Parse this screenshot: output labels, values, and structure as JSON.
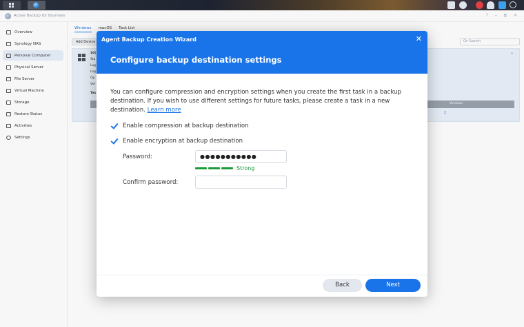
{
  "app": {
    "title": "Active Backup for Business",
    "window_controls": "? – ⧉ ✕"
  },
  "sidebar": {
    "items": [
      {
        "label": "Overview",
        "icon": "overview-icon",
        "active": false
      },
      {
        "label": "Synology NAS",
        "icon": "nas-icon",
        "active": false
      },
      {
        "label": "Personal Computer",
        "icon": "computer-icon",
        "active": true
      },
      {
        "label": "Physical Server",
        "icon": "server-icon",
        "active": false
      },
      {
        "label": "File Server",
        "icon": "file-server-icon",
        "active": false
      },
      {
        "label": "Virtual Machine",
        "icon": "vm-icon",
        "active": false
      },
      {
        "label": "Storage",
        "icon": "storage-icon",
        "active": false
      },
      {
        "label": "Restore Status",
        "icon": "restore-icon",
        "active": false
      },
      {
        "label": "Activities",
        "icon": "activities-icon",
        "active": false
      },
      {
        "label": "Settings",
        "icon": "gear-icon",
        "active": false
      }
    ]
  },
  "main": {
    "tabs": [
      "Windows",
      "macOS",
      "Task List"
    ],
    "active_tab": "Windows",
    "add_device_label": "Add Device",
    "search_placeholder": "Q▾ Search",
    "device": {
      "name_partial": "10(",
      "lines": [
        "Sta",
        "Log",
        "Log",
        "Op",
        "Ver"
      ],
      "tasks_label": "Tas"
    },
    "grid": {
      "col_versions": "Versions",
      "versions_value": "2"
    }
  },
  "wizard": {
    "window_title": "Agent Backup Creation Wizard",
    "close_glyph": "✕",
    "step_title": "Configure backup destination settings",
    "description": "You can configure compression and encryption settings when you create the first task in a backup destination. If you wish to use different settings for future tasks, please create a task in a new destination.",
    "learn_more": "Learn more",
    "options": [
      {
        "label": "Enable compression at backup destination",
        "checked": true
      },
      {
        "label": "Enable encryption at backup destination",
        "checked": true
      }
    ],
    "password": {
      "label": "Password:",
      "value": "●●●●●●●●●●●",
      "strength": "Strong",
      "strength_level": 1.0,
      "strength_color": "#1c9a38"
    },
    "confirm_password": {
      "label": "Confirm password:",
      "value": ""
    },
    "buttons": {
      "back": "Back",
      "next": "Next"
    }
  },
  "colors": {
    "accent": "#1a74e9",
    "link": "#1a73e8",
    "strong": "#1c9a38"
  }
}
